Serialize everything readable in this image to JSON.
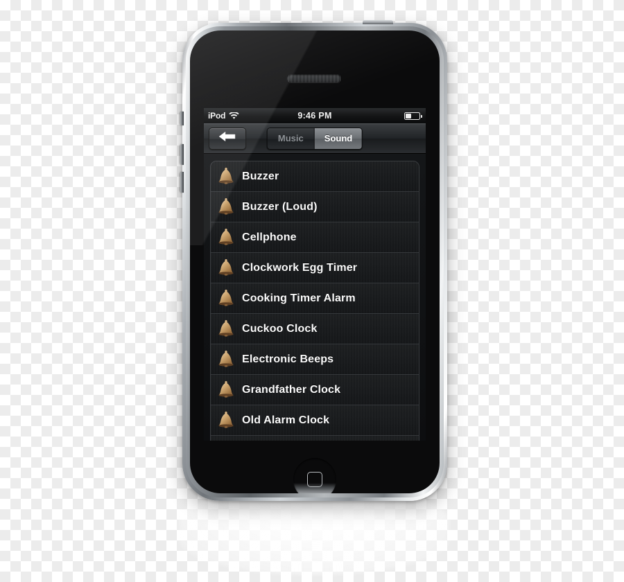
{
  "device": {
    "name": "iphone-3g",
    "earpiece": "earpiece-speaker",
    "home_button": "home-button"
  },
  "status_bar": {
    "carrier": "iPod",
    "wifi_icon": "wifi-icon",
    "time": "9:46 PM",
    "battery_icon": "battery-icon",
    "battery_percent": 40
  },
  "nav_bar": {
    "back_icon": "back-arrow-icon",
    "segmented_control": {
      "options": [
        {
          "label": "Music",
          "selected": false
        },
        {
          "label": "Sound",
          "selected": true
        }
      ],
      "selected": "Sound"
    }
  },
  "sound_list": {
    "row_icon": "bell-icon",
    "items": [
      {
        "label": "Buzzer"
      },
      {
        "label": "Buzzer (Loud)"
      },
      {
        "label": "Cellphone"
      },
      {
        "label": "Clockwork Egg Timer"
      },
      {
        "label": "Cooking Timer Alarm"
      },
      {
        "label": "Cuckoo Clock"
      },
      {
        "label": "Electronic Beeps"
      },
      {
        "label": "Grandfather Clock"
      },
      {
        "label": "Old Alarm Clock"
      }
    ]
  },
  "colors": {
    "bell_gold_light": "#e8caa0",
    "bell_gold": "#c69f6d",
    "bell_bronze": "#8a6138",
    "row_text": "#fbfbfb",
    "segment_selected_text": "#ffffff",
    "segment_unselected_text": "#8c9094",
    "screen_background": "#0d0e10"
  }
}
